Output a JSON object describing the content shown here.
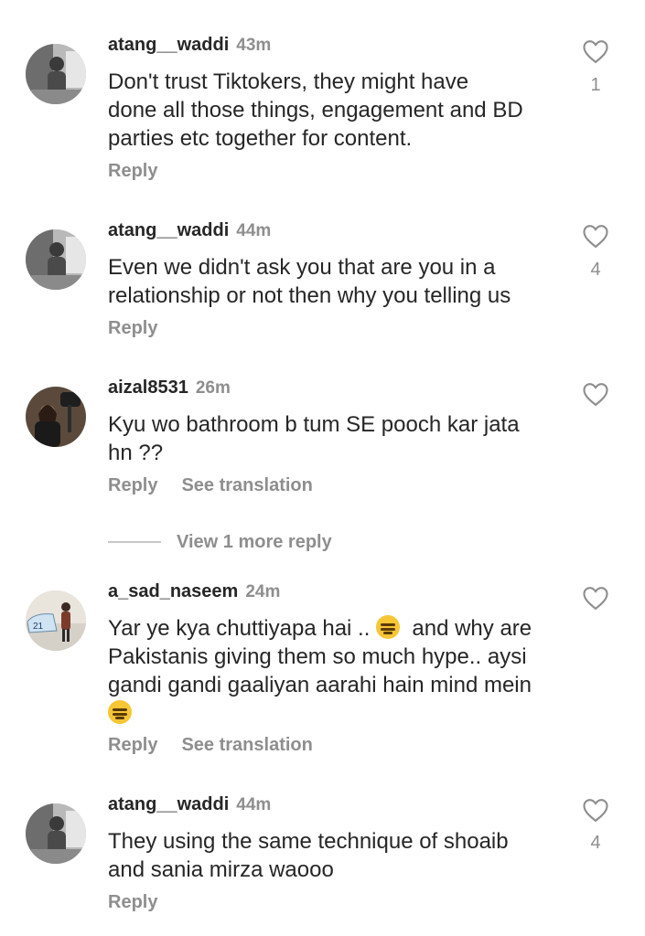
{
  "comments": [
    {
      "username": "atang__waddi",
      "time": "43m",
      "text": "Don't trust Tiktokers, they might have\ndone all those things, engagement and BD\nparties etc together for content.",
      "likes": "1",
      "reply_label": "Reply"
    },
    {
      "username": "atang__waddi",
      "time": "44m",
      "text": "Even we didn't ask you that are you in a\nrelationship or not then why you telling us",
      "likes": "4",
      "reply_label": "Reply"
    },
    {
      "username": "aizal8531",
      "time": "26m",
      "text": "Kyu wo bathroom b tum SE pooch kar jata\nhn ??",
      "reply_label": "Reply",
      "translate_label": "See translation"
    },
    {
      "username": "a_sad_naseem",
      "time": "24m",
      "text_line1_a": "Yar ye kya chuttiyapa hai .. ",
      "text_line1_b": "  and why are",
      "text_rest": "Pakistanis giving them so much hype.. aysi\ngandi gandi gaaliyan aarahi hain mind mein",
      "emoji": "expressionless-face",
      "reply_label": "Reply",
      "translate_label": "See translation"
    },
    {
      "username": "atang__waddi",
      "time": "44m",
      "text": "They using the same technique of shoaib\nand sania mirza waooo",
      "likes": "4",
      "reply_label": "Reply"
    }
  ],
  "view_more_label": "View 1 more reply",
  "icons": {
    "like": "heart-outline-icon"
  },
  "colors": {
    "text": "#262626",
    "secondary": "#8e8e8e",
    "background": "#ffffff"
  }
}
